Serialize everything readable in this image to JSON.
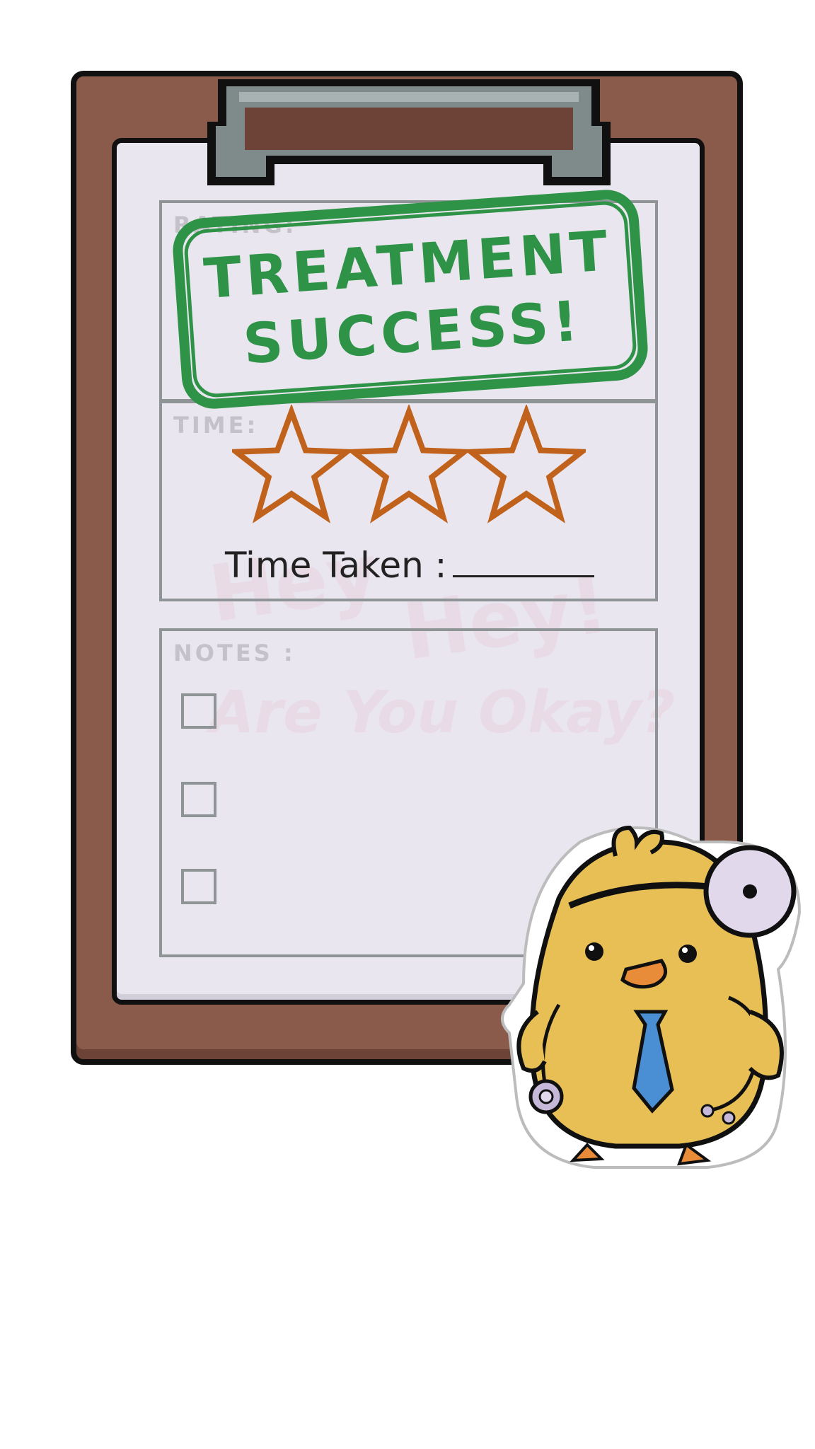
{
  "clipboard": {
    "rating_label": "RATING:",
    "time_label": "TIME:",
    "notes_label": "NOTES :",
    "time_taken_label": "Time Taken :",
    "time_taken_value": ""
  },
  "stamp": {
    "line1": "TREATMENT",
    "line2": "SUCCESS!",
    "color": "#2e9346"
  },
  "watermark": {
    "line1": "Hey",
    "line2": "Hey!",
    "line3": "Are You Okay?"
  },
  "rating": {
    "stars_total": 3,
    "stars_filled": 0,
    "star_color": "#c0621b"
  },
  "notes": {
    "checkboxes": [
      {
        "checked": false
      },
      {
        "checked": false
      },
      {
        "checked": false
      }
    ]
  },
  "colors": {
    "board": "#8a5a4a",
    "paper": "#e9e6ef",
    "chick_body": "#e8bf55",
    "tie": "#4a8fd4",
    "stethoscope": "#c6b8d8"
  },
  "icons": [
    "clipboard-clip-icon",
    "star-icon",
    "doctor-chick-mascot-icon"
  ]
}
